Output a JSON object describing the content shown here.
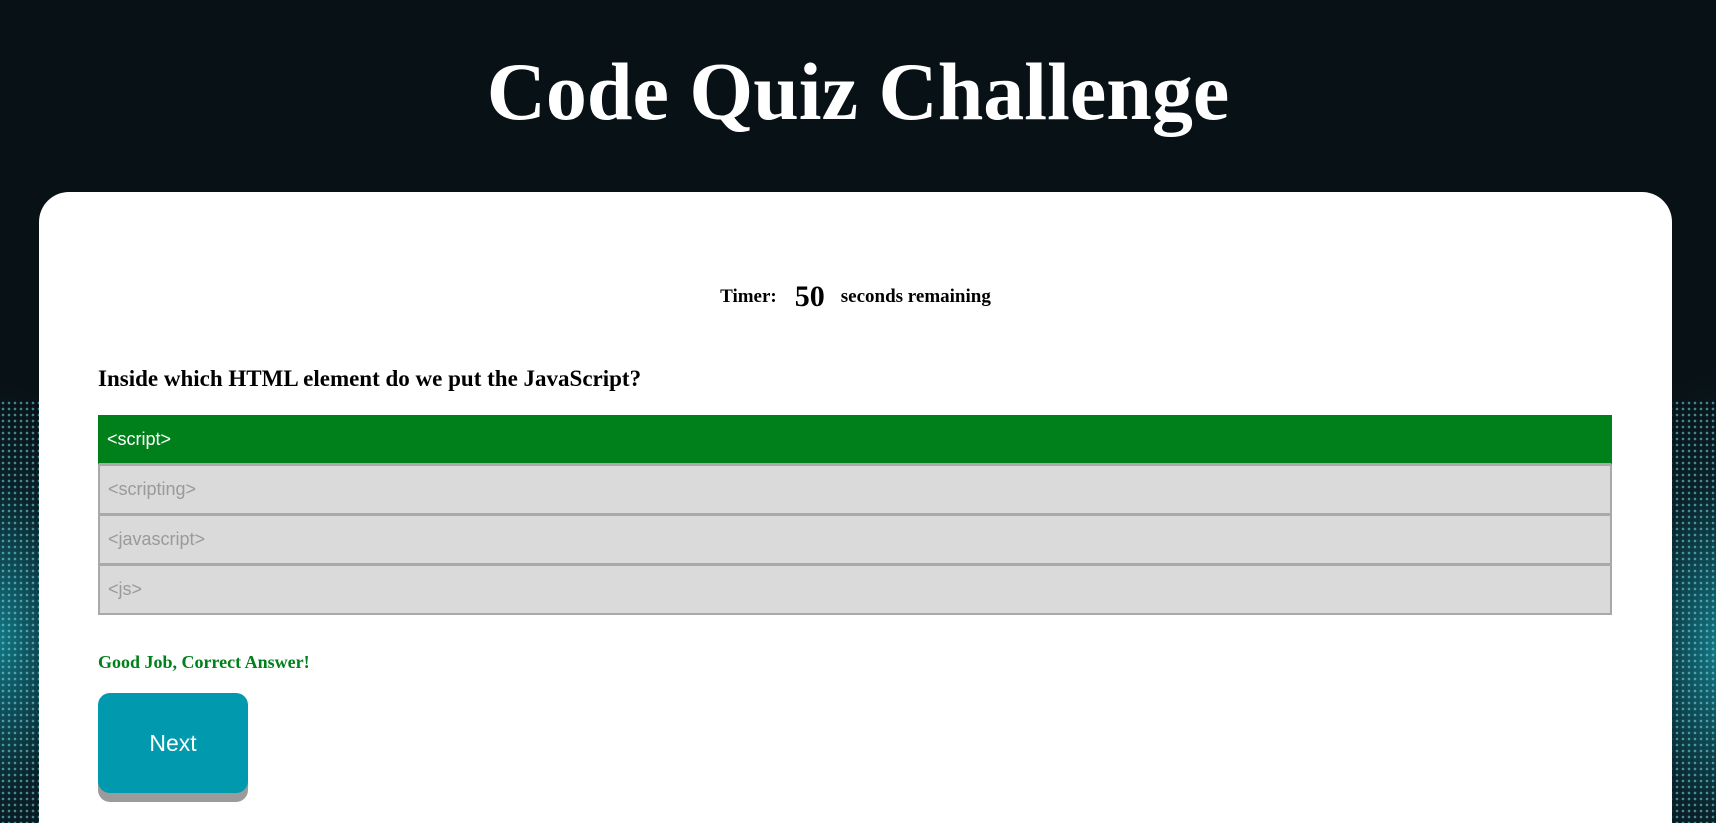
{
  "header": {
    "title": "Code Quiz Challenge"
  },
  "timer": {
    "label": "Timer:",
    "value": "50",
    "suffix": "seconds remaining"
  },
  "question": {
    "text": "Inside which HTML element do we put the JavaScript?",
    "answers": [
      {
        "label": "<script>",
        "state": "correct"
      },
      {
        "label": "<scripting>",
        "state": "unselected"
      },
      {
        "label": "<javascript>",
        "state": "unselected"
      },
      {
        "label": "<js>",
        "state": "unselected"
      }
    ]
  },
  "feedback": {
    "text": "Good Job, Correct Answer!",
    "color": "#00801a"
  },
  "controls": {
    "next_label": "Next"
  },
  "colors": {
    "background": "#081116",
    "card": "#ffffff",
    "correct": "#00801a",
    "answer_default": "#dadada",
    "button": "#0099ae"
  }
}
